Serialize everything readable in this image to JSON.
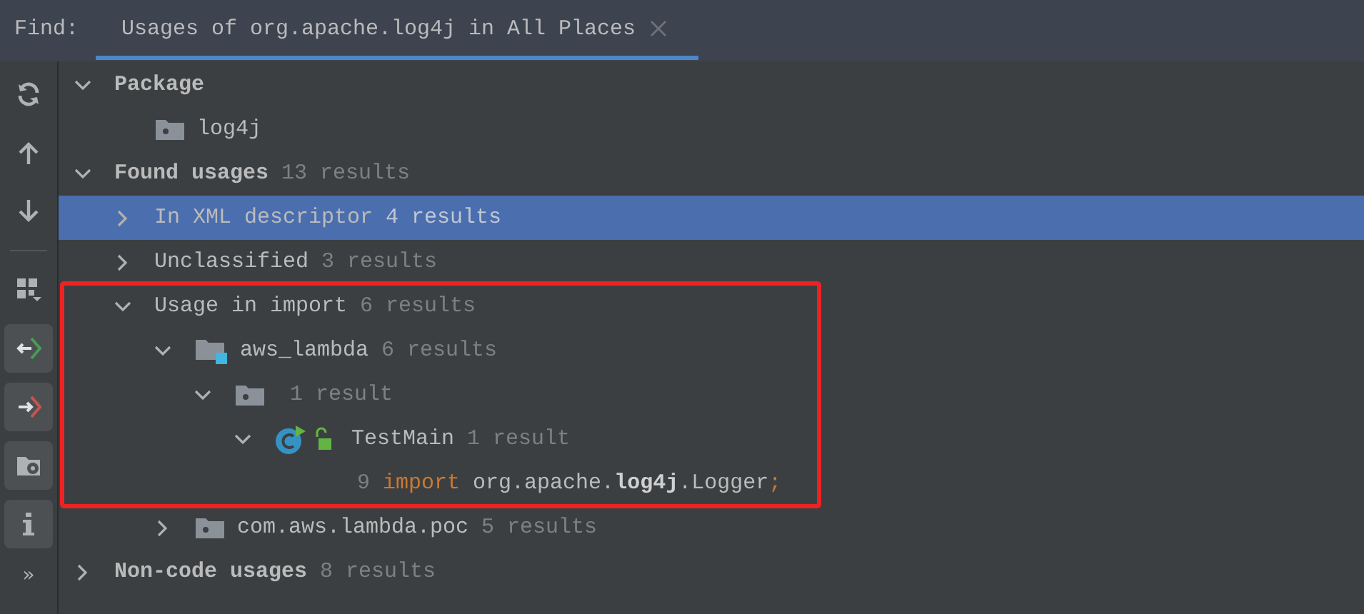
{
  "find_bar": {
    "label": "Find:",
    "tab": {
      "title": "Usages of org.apache.log4j in All Places",
      "selected": true
    }
  },
  "toolbar": [
    {
      "kind": "refresh",
      "on": false
    },
    {
      "kind": "up",
      "on": false
    },
    {
      "kind": "down",
      "on": false
    },
    {
      "kind": "divider"
    },
    {
      "kind": "group",
      "on": false
    },
    {
      "kind": "import",
      "on": true
    },
    {
      "kind": "export",
      "on": true
    },
    {
      "kind": "folder-settings",
      "on": true
    },
    {
      "kind": "info",
      "on": true
    },
    {
      "kind": "more",
      "text": "»"
    }
  ],
  "tree": [
    {
      "kind": "group",
      "label": "Package",
      "expanded": true,
      "selected": false,
      "children": [
        {
          "kind": "package",
          "label": "log4j",
          "selected": false
        }
      ]
    },
    {
      "kind": "group",
      "label": "Found usages",
      "count": "13 results",
      "expanded": true,
      "selected": false,
      "children": [
        {
          "kind": "category",
          "label": "In XML descriptor",
          "count": "4 results",
          "expanded": false,
          "selected": true
        },
        {
          "kind": "category",
          "label": "Unclassified",
          "count": "3 results",
          "expanded": false,
          "selected": false
        },
        {
          "kind": "category",
          "label": "Usage in import",
          "count": "6 results",
          "expanded": true,
          "selected": false,
          "highlighted": true,
          "children": [
            {
              "kind": "module",
              "label": "aws_lambda",
              "count": "6 results",
              "expanded": true,
              "selected": false,
              "highlighted": true,
              "children": [
                {
                  "kind": "package",
                  "count": "1 result",
                  "expanded": true,
                  "selected": false,
                  "highlighted": true,
                  "children": [
                    {
                      "kind": "class",
                      "label": "TestMain",
                      "count": "1 result",
                      "expanded": true,
                      "selected": false,
                      "highlighted": true,
                      "children": [
                        {
                          "kind": "code",
                          "line": "9",
                          "keyword": "import",
                          "text": "org.apache.**log4j**.Logger",
                          "end": ";",
                          "selected": false,
                          "highlighted": true
                        }
                      ]
                    }
                  ]
                }
              ]
            },
            {
              "kind": "package",
              "label": "com.aws.lambda.poc",
              "count": "5 results",
              "expanded": false,
              "selected": false
            }
          ]
        }
      ]
    },
    {
      "kind": "group",
      "label": "Non-code usages",
      "count": "8 results",
      "expanded": false,
      "selected": false
    }
  ]
}
